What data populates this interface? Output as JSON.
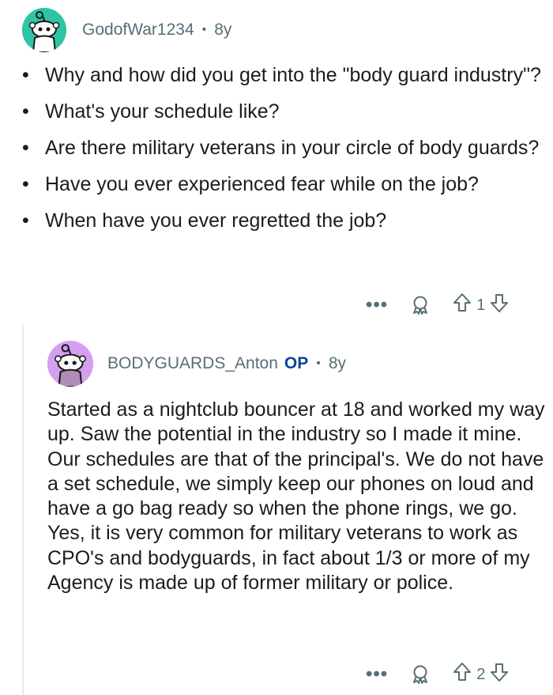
{
  "comment": {
    "username": "GodofWar1234",
    "separator": "•",
    "age": "8y",
    "questions": [
      "Why and how did you get into the \"body guard industry\"?",
      "What's your schedule like?",
      "Are there military veterans in your circle of body guards?",
      "Have you ever experienced fear while on the job?",
      "When have you ever regretted the job?"
    ],
    "bullet": "•",
    "more_label": "•••",
    "vote_count": "1",
    "avatar_color": "#2ec4a6"
  },
  "reply": {
    "username": "BODYGUARDS_Anton",
    "op_badge": "OP",
    "separator": "•",
    "age": "8y",
    "body": "Started as a nightclub bouncer at 18 and worked my way up.  Saw the potential in the industry so I made it mine. Our schedules are that of the principal's.  We do not have a set schedule, we simply keep our phones on loud and have a go bag ready so when the phone rings, we go. Yes, it is very common for military veterans to work as CPO's and bodyguards, in fact about 1/3 or more of my Agency is made up of former military or police.",
    "more_label": "•••",
    "vote_count": "2",
    "avatar_color": "#d59ff0"
  },
  "icons": {
    "award": "award-icon",
    "upvote": "upvote-arrow-icon",
    "downvote": "downvote-arrow-icon",
    "more": "more-options-icon",
    "avatar": "snoo-avatar-icon"
  }
}
